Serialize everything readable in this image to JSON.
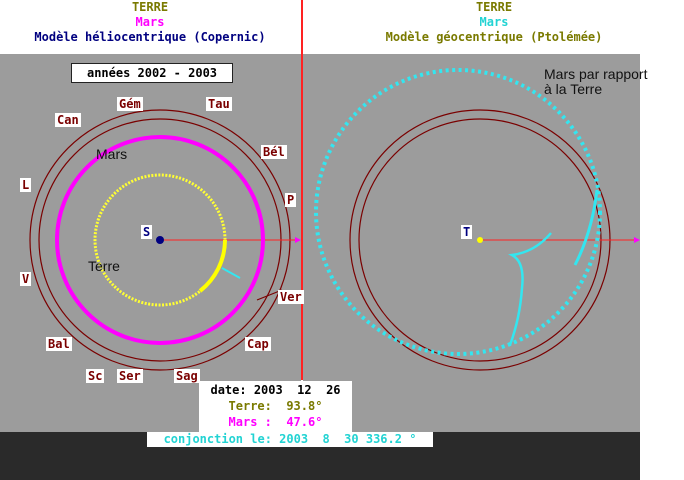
{
  "left_header": {
    "line1": "TERRE",
    "line2": "Mars",
    "line3": "Modèle héliocentrique (Copernic)"
  },
  "right_header": {
    "line1": "TERRE",
    "line2": "Mars",
    "line3": "Modèle géocentrique (Ptolémée)"
  },
  "years_label": "années 2002 - 2003",
  "zodiac": {
    "gem": "Gém",
    "tau": "Tau",
    "can": "Can",
    "bel": "Bél",
    "l": "L",
    "p": "P",
    "v": "V",
    "ver": "Ver",
    "bal": "Bal",
    "cap": "Cap",
    "sc": "Sc",
    "ser": "Ser",
    "sag": "Sag"
  },
  "left_labels": {
    "mars": "Mars",
    "terre": "Terre",
    "sun": "S"
  },
  "right_labels": {
    "earth": "T",
    "note_line1": "Mars par rapport",
    "note_line2": "à la Terre"
  },
  "info": {
    "date": "date: 2003  12  26",
    "terre": "Terre:  93.8°",
    "mars": "Mars :  47.6°"
  },
  "conjunction": "conjonction le: 2003  8  30 336.2 °",
  "colors": {
    "earth_orbit": "#ffff33",
    "mars_orbit": "#ff00ff",
    "geo_path": "#33e6f0",
    "ring": "#7a0000",
    "axis": "#ff2222",
    "title_olive": "#7a7a00",
    "title_navy": "#000080"
  }
}
